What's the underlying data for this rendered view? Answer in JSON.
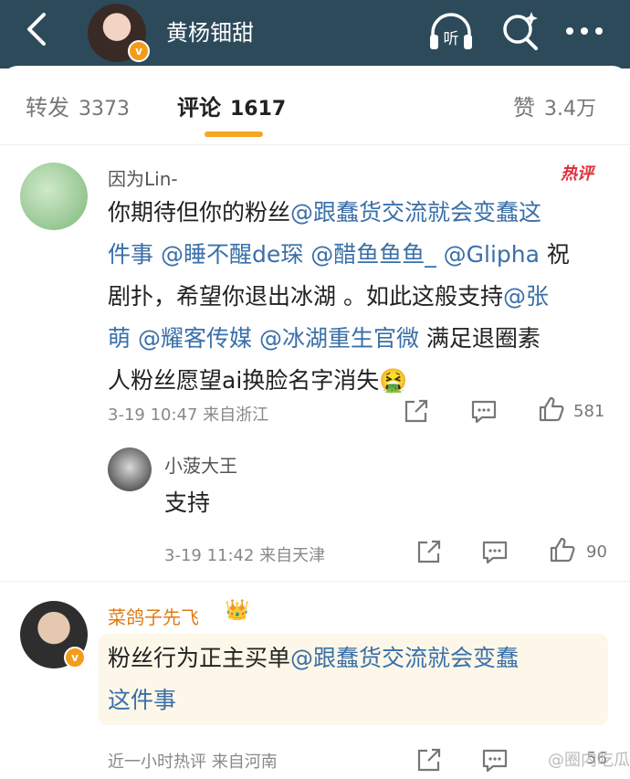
{
  "header": {
    "title": "黄杨钿甜",
    "badge": "v",
    "listen_label": "听"
  },
  "tabs": {
    "repost_label": "转发",
    "repost_count": "3373",
    "comment_label": "评论",
    "comment_count": "1617",
    "like_label": "赞",
    "like_count": "3.4万"
  },
  "comments": [
    {
      "user": "因为Lin-",
      "hot_tag": "热评",
      "text_lines": [
        [
          "你期待但你的粉丝",
          "@跟蠢货交流就会变蠢这"
        ],
        [
          "件事",
          "@睡不醒de琛",
          "@醋鱼鱼鱼_",
          "@Glipha",
          "祝"
        ],
        [
          "剧扑，希望你退出冰湖 。如此这般支持",
          "@张"
        ],
        [
          "萌",
          "@耀客传媒",
          "@冰湖重生官微",
          "满足退圈素"
        ],
        [
          "人粉丝愿望ai换脸名字消失",
          "🤮"
        ]
      ],
      "meta": "3-19 10:47  来自浙江",
      "like_count": "581"
    },
    {
      "user": "小菠大王",
      "text": "支持",
      "meta": "3-19 11:42  来自天津",
      "like_count": "90"
    },
    {
      "user": "菜鸽子先飞",
      "crown": "👑",
      "text_line1_a": "粉丝行为正主买单",
      "text_line1_b": "@跟蠢货交流就会变蠢",
      "text_line2": "这件事",
      "meta": "近一小时热评  来自河南",
      "like_count": "56"
    }
  ],
  "watermark": "@圈内吃瓜",
  "colors": {
    "topbar": "#2c4a5a",
    "accent": "#f5a623",
    "mention": "#3a6fa8",
    "hot": "#e0303a"
  },
  "icons": [
    "back-icon",
    "listen-icon",
    "search-icon",
    "more-icon",
    "share-icon",
    "comment-icon",
    "like-icon",
    "verified-badge-icon",
    "crown-icon"
  ]
}
